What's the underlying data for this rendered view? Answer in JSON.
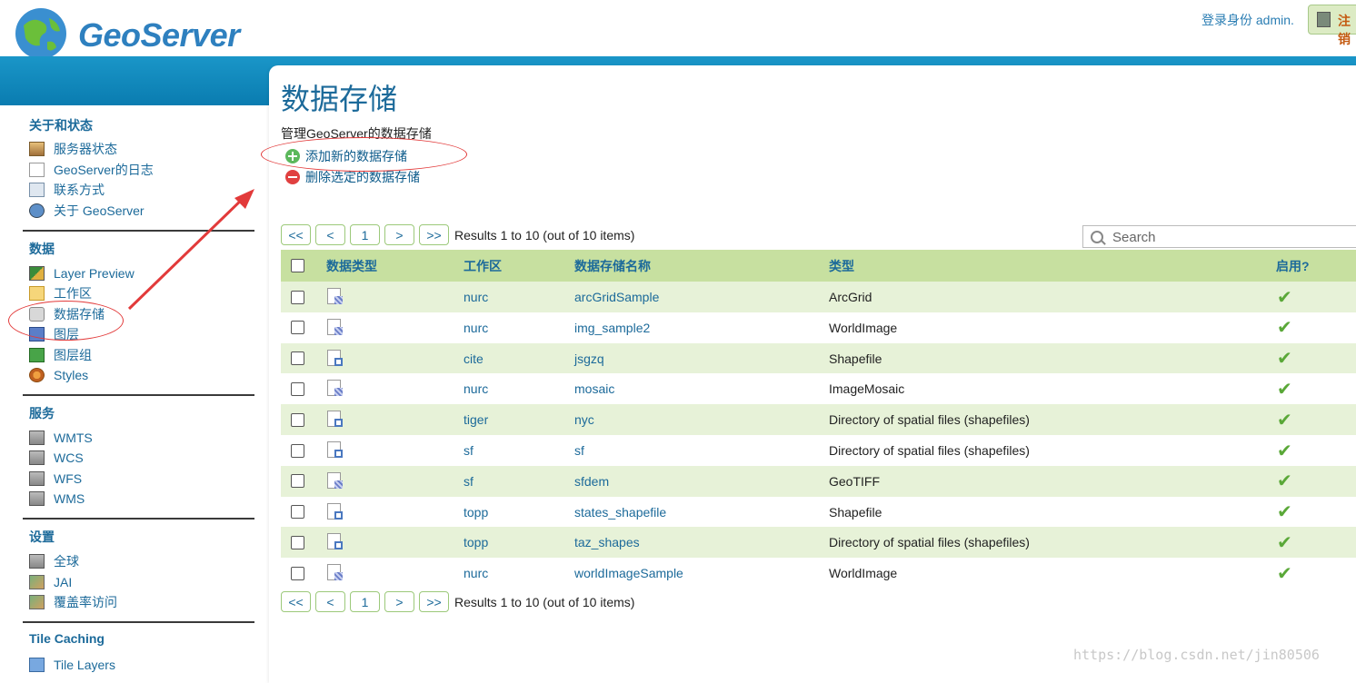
{
  "header": {
    "logo_text": "GeoServer",
    "login_text": "登录身份 admin.",
    "logout_label": "注销"
  },
  "sidebar": {
    "sections": [
      {
        "title": "关于和状态",
        "items": [
          {
            "label": "服务器状态",
            "icon": "server-status-icon"
          },
          {
            "label": "GeoServer的日志",
            "icon": "log-icon"
          },
          {
            "label": "联系方式",
            "icon": "contact-icon"
          },
          {
            "label": "关于 GeoServer",
            "icon": "about-icon"
          }
        ]
      },
      {
        "title": "数据",
        "items": [
          {
            "label": "Layer Preview",
            "icon": "layer-preview-icon"
          },
          {
            "label": "工作区",
            "icon": "folder-icon"
          },
          {
            "label": "数据存储",
            "icon": "datastore-icon"
          },
          {
            "label": "图层",
            "icon": "layer-icon"
          },
          {
            "label": "图层组",
            "icon": "layer-group-icon"
          },
          {
            "label": "Styles",
            "icon": "styles-icon"
          }
        ]
      },
      {
        "title": "服务",
        "items": [
          {
            "label": "WMTS",
            "icon": "service-icon"
          },
          {
            "label": "WCS",
            "icon": "service-icon"
          },
          {
            "label": "WFS",
            "icon": "service-icon"
          },
          {
            "label": "WMS",
            "icon": "service-icon"
          }
        ]
      },
      {
        "title": "设置",
        "items": [
          {
            "label": "全球",
            "icon": "global-settings-icon"
          },
          {
            "label": "JAI",
            "icon": "jai-icon"
          },
          {
            "label": "覆盖率访问",
            "icon": "coverage-access-icon"
          }
        ]
      },
      {
        "title": "Tile Caching",
        "items": [
          {
            "label": "Tile Layers",
            "icon": "tile-layers-icon"
          }
        ]
      }
    ]
  },
  "main": {
    "title": "数据存储",
    "description": "管理GeoServer的数据存储",
    "add_label": "添加新的数据存储",
    "remove_label": "删除选定的数据存储",
    "pager": {
      "first": "<<",
      "prev": "<",
      "page": "1",
      "next": ">",
      "last": ">>",
      "info": "Results 1 to 10 (out of 10 items)"
    },
    "search_placeholder": "Search",
    "table": {
      "headers": {
        "type": "数据类型",
        "workspace": "工作区",
        "name": "数据存储名称",
        "kind": "类型",
        "enabled": "启用?"
      },
      "rows": [
        {
          "icon": "raster",
          "workspace": "nurc",
          "name": "arcGridSample",
          "kind": "ArcGrid",
          "enabled": "✔"
        },
        {
          "icon": "raster",
          "workspace": "nurc",
          "name": "img_sample2",
          "kind": "WorldImage",
          "enabled": "✔"
        },
        {
          "icon": "vector",
          "workspace": "cite",
          "name": "jsgzq",
          "kind": "Shapefile",
          "enabled": "✔"
        },
        {
          "icon": "raster",
          "workspace": "nurc",
          "name": "mosaic",
          "kind": "ImageMosaic",
          "enabled": "✔"
        },
        {
          "icon": "vector",
          "workspace": "tiger",
          "name": "nyc",
          "kind": "Directory of spatial files (shapefiles)",
          "enabled": "✔"
        },
        {
          "icon": "vector",
          "workspace": "sf",
          "name": "sf",
          "kind": "Directory of spatial files (shapefiles)",
          "enabled": "✔"
        },
        {
          "icon": "raster",
          "workspace": "sf",
          "name": "sfdem",
          "kind": "GeoTIFF",
          "enabled": "✔"
        },
        {
          "icon": "vector",
          "workspace": "topp",
          "name": "states_shapefile",
          "kind": "Shapefile",
          "enabled": "✔"
        },
        {
          "icon": "vector",
          "workspace": "topp",
          "name": "taz_shapes",
          "kind": "Directory of spatial files (shapefiles)",
          "enabled": "✔"
        },
        {
          "icon": "raster",
          "workspace": "nurc",
          "name": "worldImageSample",
          "kind": "WorldImage",
          "enabled": "✔"
        }
      ]
    }
  },
  "watermark": "https://blog.csdn.net/jin80506",
  "colors": {
    "accent": "#1c6a9a",
    "header_band": "#0a7cb0",
    "row_stripe": "#e7f2d8",
    "header_row": "#c7e0a0",
    "annotation": "#e23a3a"
  }
}
